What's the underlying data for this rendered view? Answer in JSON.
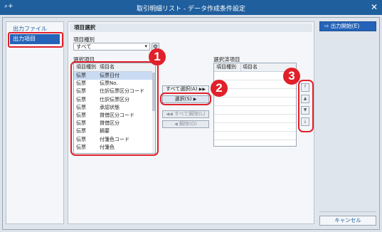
{
  "window": {
    "title": "取引明細リスト - データ作成条件設定",
    "app_icon": "search-plus-icon",
    "close_label": "✕"
  },
  "sidebar": {
    "items": [
      {
        "label": "出力ファイル",
        "active": false
      },
      {
        "label": "出力項目",
        "active": true
      }
    ]
  },
  "main": {
    "section_title": "項目選択",
    "type_label": "項目種別",
    "type_value": "すべて",
    "available_label": "選択項目",
    "available_columns": [
      "項目種別",
      "項目名"
    ],
    "available_rows": [
      [
        "伝票",
        "伝票日付"
      ],
      [
        "伝票",
        "伝票No."
      ],
      [
        "伝票",
        "仕訳伝票区分コード"
      ],
      [
        "伝票",
        "仕訳伝票区分"
      ],
      [
        "伝票",
        "承認状態"
      ],
      [
        "伝票",
        "貸借区分コード"
      ],
      [
        "伝票",
        "貸借区分"
      ],
      [
        "伝票",
        "摘要"
      ],
      [
        "伝票",
        "付箋色コード"
      ],
      [
        "伝票",
        "付箋色"
      ]
    ],
    "selected_label": "選択済項目",
    "selected_columns": [
      "項目種別",
      "項目名"
    ],
    "buttons": {
      "select_all": "すべて選択(A)",
      "select": "選択(S)",
      "deselect_all": "すべて解除(L)",
      "deselect": "解除(D)"
    },
    "order_buttons": [
      "move-top-icon",
      "move-up-icon",
      "move-down-icon",
      "move-bottom-icon"
    ]
  },
  "actions": {
    "start_label": "出力開始(E)",
    "cancel_label": "キャンセル"
  },
  "callouts": [
    "1",
    "2",
    "3"
  ],
  "colors": {
    "titlebar": "#1f5f9e",
    "accent": "#2563b8",
    "callout": "#e0202a"
  }
}
